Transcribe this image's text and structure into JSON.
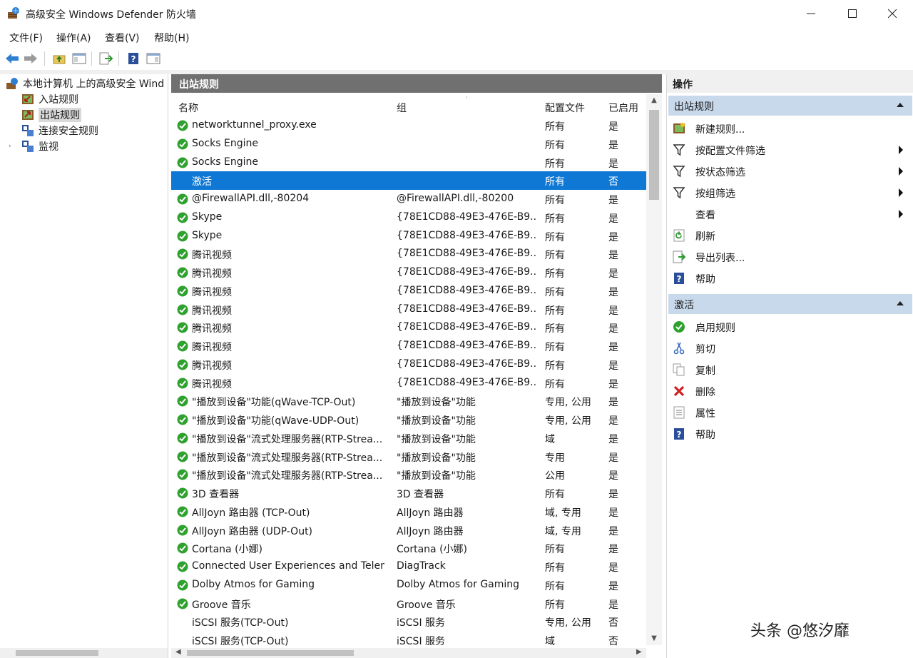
{
  "window": {
    "title": "高级安全 Windows Defender 防火墙",
    "controls": [
      "minimize",
      "maximize",
      "close"
    ]
  },
  "menu": [
    "文件(F)",
    "操作(A)",
    "查看(V)",
    "帮助(H)"
  ],
  "toolbar": [
    "back-icon",
    "forward-icon",
    "up-folder-icon",
    "show-hide-tree-icon",
    "export-icon",
    "help-icon",
    "action-pane-icon"
  ],
  "tree": {
    "root": "本地计算机 上的高级安全 Wind",
    "items": [
      "入站规则",
      "出站规则",
      "连接安全规则",
      "监视"
    ],
    "selected": "出站规则"
  },
  "center": {
    "title": "出站规则",
    "columns": [
      "名称",
      "组",
      "配置文件",
      "已启用"
    ],
    "rows": [
      {
        "name": "networktunnel_proxy.exe",
        "group": "",
        "profile": "所有",
        "enabled": "是",
        "status": "on"
      },
      {
        "name": "Socks Engine",
        "group": "",
        "profile": "所有",
        "enabled": "是",
        "status": "on"
      },
      {
        "name": "Socks Engine",
        "group": "",
        "profile": "所有",
        "enabled": "是",
        "status": "on"
      },
      {
        "name": "激活",
        "group": "",
        "profile": "所有",
        "enabled": "否",
        "status": "none",
        "selected": true
      },
      {
        "name": "@FirewallAPI.dll,-80204",
        "group": "@FirewallAPI.dll,-80200",
        "profile": "所有",
        "enabled": "是",
        "status": "on"
      },
      {
        "name": "Skype",
        "group": "{78E1CD88-49E3-476E-B9...",
        "profile": "所有",
        "enabled": "是",
        "status": "on"
      },
      {
        "name": "Skype",
        "group": "{78E1CD88-49E3-476E-B9...",
        "profile": "所有",
        "enabled": "是",
        "status": "on"
      },
      {
        "name": "腾讯视频",
        "group": "{78E1CD88-49E3-476E-B9...",
        "profile": "所有",
        "enabled": "是",
        "status": "on"
      },
      {
        "name": "腾讯视频",
        "group": "{78E1CD88-49E3-476E-B9...",
        "profile": "所有",
        "enabled": "是",
        "status": "on"
      },
      {
        "name": "腾讯视频",
        "group": "{78E1CD88-49E3-476E-B9...",
        "profile": "所有",
        "enabled": "是",
        "status": "on"
      },
      {
        "name": "腾讯视频",
        "group": "{78E1CD88-49E3-476E-B9...",
        "profile": "所有",
        "enabled": "是",
        "status": "on"
      },
      {
        "name": "腾讯视频",
        "group": "{78E1CD88-49E3-476E-B9...",
        "profile": "所有",
        "enabled": "是",
        "status": "on"
      },
      {
        "name": "腾讯视频",
        "group": "{78E1CD88-49E3-476E-B9...",
        "profile": "所有",
        "enabled": "是",
        "status": "on"
      },
      {
        "name": "腾讯视频",
        "group": "{78E1CD88-49E3-476E-B9...",
        "profile": "所有",
        "enabled": "是",
        "status": "on"
      },
      {
        "name": "腾讯视频",
        "group": "{78E1CD88-49E3-476E-B9...",
        "profile": "所有",
        "enabled": "是",
        "status": "on"
      },
      {
        "name": "\"播放到设备\"功能(qWave-TCP-Out)",
        "group": "\"播放到设备\"功能",
        "profile": "专用, 公用",
        "enabled": "是",
        "status": "on"
      },
      {
        "name": "\"播放到设备\"功能(qWave-UDP-Out)",
        "group": "\"播放到设备\"功能",
        "profile": "专用, 公用",
        "enabled": "是",
        "status": "on"
      },
      {
        "name": "\"播放到设备\"流式处理服务器(RTP-Strea...",
        "group": "\"播放到设备\"功能",
        "profile": "域",
        "enabled": "是",
        "status": "on"
      },
      {
        "name": "\"播放到设备\"流式处理服务器(RTP-Strea...",
        "group": "\"播放到设备\"功能",
        "profile": "专用",
        "enabled": "是",
        "status": "on"
      },
      {
        "name": "\"播放到设备\"流式处理服务器(RTP-Strea...",
        "group": "\"播放到设备\"功能",
        "profile": "公用",
        "enabled": "是",
        "status": "on"
      },
      {
        "name": "3D 查看器",
        "group": "3D 查看器",
        "profile": "所有",
        "enabled": "是",
        "status": "on"
      },
      {
        "name": "AllJoyn 路由器 (TCP-Out)",
        "group": "AllJoyn 路由器",
        "profile": "域, 专用",
        "enabled": "是",
        "status": "on"
      },
      {
        "name": "AllJoyn 路由器 (UDP-Out)",
        "group": "AllJoyn 路由器",
        "profile": "域, 专用",
        "enabled": "是",
        "status": "on"
      },
      {
        "name": "Cortana (小娜)",
        "group": "Cortana (小娜)",
        "profile": "所有",
        "enabled": "是",
        "status": "on"
      },
      {
        "name": "Connected User Experiences and Telem...",
        "group": "DiagTrack",
        "profile": "所有",
        "enabled": "是",
        "status": "on"
      },
      {
        "name": "Dolby Atmos for Gaming",
        "group": "Dolby Atmos for Gaming",
        "profile": "所有",
        "enabled": "是",
        "status": "on"
      },
      {
        "name": "Groove 音乐",
        "group": "Groove 音乐",
        "profile": "所有",
        "enabled": "是",
        "status": "on"
      },
      {
        "name": "iSCSI 服务(TCP-Out)",
        "group": "iSCSI 服务",
        "profile": "专用, 公用",
        "enabled": "否",
        "status": "none"
      },
      {
        "name": "iSCSI 服务(TCP-Out)",
        "group": "iSCSI 服务",
        "profile": "域",
        "enabled": "否",
        "status": "none"
      }
    ]
  },
  "actions": {
    "title": "操作",
    "sections": [
      {
        "title": "出站规则",
        "items": [
          {
            "label": "新建规则...",
            "icon": "new-rule-icon",
            "submenu": false
          },
          {
            "label": "按配置文件筛选",
            "icon": "filter-icon",
            "submenu": true
          },
          {
            "label": "按状态筛选",
            "icon": "filter-icon",
            "submenu": true
          },
          {
            "label": "按组筛选",
            "icon": "filter-icon",
            "submenu": true
          },
          {
            "label": "查看",
            "icon": "",
            "submenu": true
          },
          {
            "label": "刷新",
            "icon": "refresh-icon",
            "submenu": false
          },
          {
            "label": "导出列表...",
            "icon": "export-icon",
            "submenu": false
          },
          {
            "label": "帮助",
            "icon": "help-icon",
            "submenu": false
          }
        ]
      },
      {
        "title": "激活",
        "items": [
          {
            "label": "启用规则",
            "icon": "enable-rule-icon",
            "submenu": false
          },
          {
            "label": "剪切",
            "icon": "cut-icon",
            "submenu": false
          },
          {
            "label": "复制",
            "icon": "copy-icon",
            "submenu": false
          },
          {
            "label": "删除",
            "icon": "delete-icon",
            "submenu": false
          },
          {
            "label": "属性",
            "icon": "properties-icon",
            "submenu": false
          },
          {
            "label": "帮助",
            "icon": "help-icon",
            "submenu": false
          }
        ]
      }
    ]
  },
  "watermark": "头条 @悠汐靡",
  "colors": {
    "selection": "#0f78d4",
    "header": "#707070",
    "section": "#c9d9ec",
    "enabled_icon": "#2fa12f"
  }
}
